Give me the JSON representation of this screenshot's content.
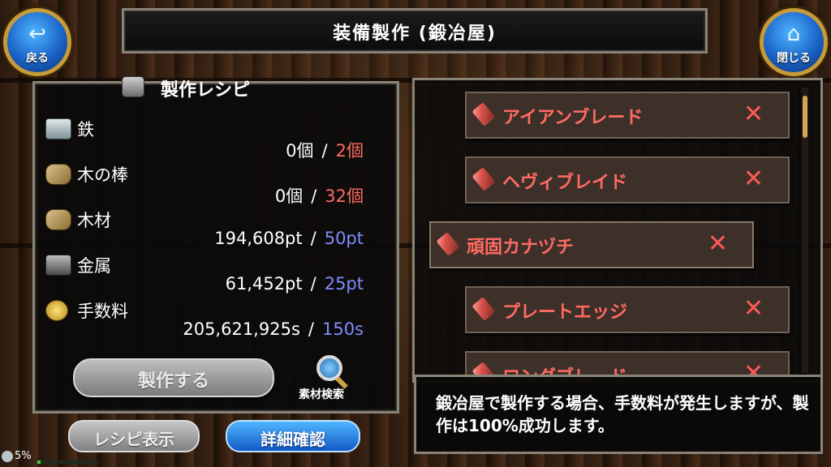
{
  "header": {
    "title": "装備製作 (鍛冶屋)",
    "back_label": "戻る",
    "close_label": "閉じる"
  },
  "recipe": {
    "header": "製作レシピ",
    "materials": [
      {
        "name": "鉄",
        "have": "0個",
        "need": "2個",
        "icon": "iron-ingot-icon",
        "need_color": "#ff6b63"
      },
      {
        "name": "木の棒",
        "have": "0個",
        "need": "32個",
        "icon": "wood-stick-icon",
        "need_color": "#ff6b63"
      },
      {
        "name": "木材",
        "have": "194,608pt",
        "need": "50pt",
        "icon": "lumber-icon",
        "need_color": "#7f8cff"
      },
      {
        "name": "金属",
        "have": "61,452pt",
        "need": "25pt",
        "icon": "metal-icon",
        "need_color": "#7f8cff"
      },
      {
        "name": "手数料",
        "have": "205,621,925s",
        "need": "150s",
        "icon": "coin-icon",
        "need_color": "#7f8cff"
      }
    ],
    "separator": "/",
    "craft_button": "製作する",
    "search_label": "素材検索"
  },
  "buttons": {
    "recipe_view": "レシピ表示",
    "detail_check": "詳細確認"
  },
  "status": {
    "percent_text": "5%",
    "progress": 0.05
  },
  "equipment_list": [
    {
      "name": "アイアンブレード",
      "mark": "✕"
    },
    {
      "name": "ヘヴィブレイド",
      "mark": "✕"
    },
    {
      "name": "頑固カナヅチ",
      "mark": "✕"
    },
    {
      "name": "プレートエッジ",
      "mark": "✕"
    },
    {
      "name": "ロングブレード",
      "mark": "✕"
    }
  ],
  "message": "鍛冶屋で製作する場合、手数料が発生しますが、製作は100%成功します。",
  "colors": {
    "need_red": "#ff6b63",
    "need_blue": "#7f8cff",
    "blue_button": "#1a63c8",
    "frame_gold": "#c79a3a"
  }
}
